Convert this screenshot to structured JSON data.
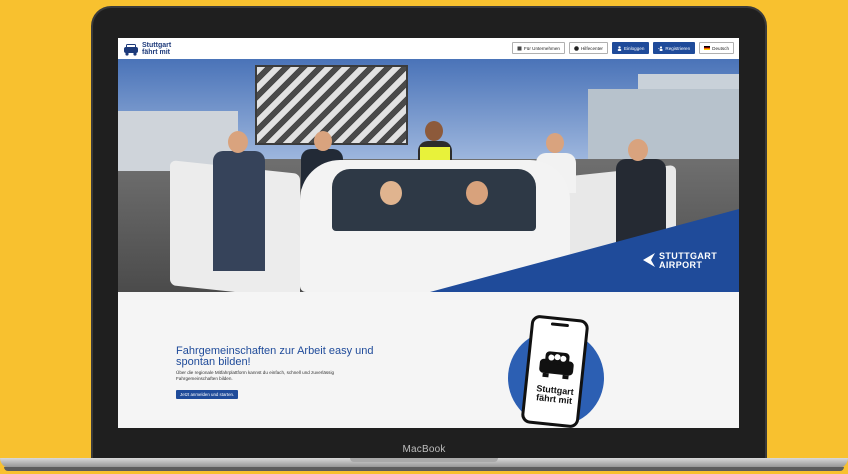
{
  "device": {
    "label": "MacBook"
  },
  "header": {
    "logo_line1": "Stuttgart",
    "logo_line2": "fährt mit",
    "nav": {
      "business": "Für Unternehmen",
      "help": "Hilfecenter",
      "login": "Einloggen",
      "register": "Registrieren",
      "language": "Deutsch"
    }
  },
  "hero": {
    "brand_line1": "STUTTGART",
    "brand_line2": "AIRPORT"
  },
  "main": {
    "headline": "Fahrgemeinschaften zur Arbeit easy und spontan bilden!",
    "subtext": "Über die regionale Mitfahrplattform kannst du einfach, schnell und zuverlässig Fahrgemeinschaften bilden.",
    "cta": "Jetzt anmelden und starten.",
    "phone_line1": "Stuttgart",
    "phone_line2": "fährt mit"
  },
  "colors": {
    "background": "#f8c12f",
    "brand_blue": "#1f4b9a"
  }
}
